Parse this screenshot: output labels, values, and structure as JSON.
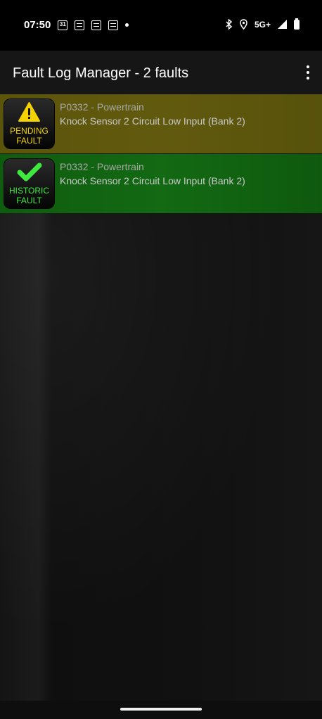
{
  "status_bar": {
    "time": "07:50",
    "calendar_day": "31",
    "network": "5G+",
    "icons": [
      "calendar-icon",
      "document-icon",
      "document-icon",
      "document-icon",
      "notification-dot",
      "bluetooth-icon",
      "location-icon",
      "signal-icon",
      "battery-icon"
    ]
  },
  "app_bar": {
    "title": "Fault Log Manager - 2 faults",
    "menu_icon": "more-vert-icon"
  },
  "faults": [
    {
      "badge_line1": "PENDING",
      "badge_line2": "FAULT",
      "badge_icon": "warning-icon",
      "code": "P0332 - Powertrain",
      "description": "Knock Sensor 2 Circuit Low Input (Bank 2)",
      "row_color": "#5e570d"
    },
    {
      "badge_line1": "HISTORIC",
      "badge_line2": "FAULT",
      "badge_icon": "checkmark-icon",
      "code": "P0332 - Powertrain",
      "description": "Knock Sensor 2 Circuit Low Input (Bank 2)",
      "row_color": "#116411"
    }
  ]
}
